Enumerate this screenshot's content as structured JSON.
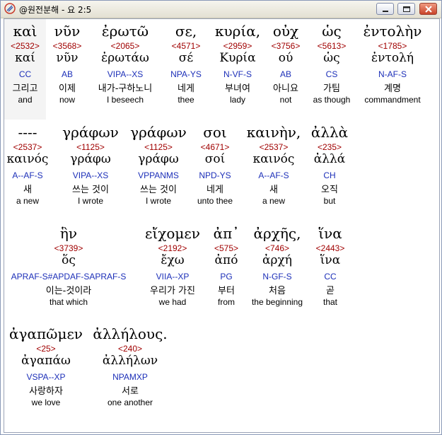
{
  "window": {
    "title": "@원전분해 - 요 2:5"
  },
  "rows": [
    {
      "words": [
        {
          "greek": "καὶ",
          "strong": "<2532>",
          "lemma": "καί",
          "morph": "CC",
          "korean": "그리고",
          "english": "and"
        },
        {
          "greek": "νῦν",
          "strong": "<3568>",
          "lemma": "νῦν",
          "morph": "AB",
          "korean": "이제",
          "english": "now"
        },
        {
          "greek": "ἐρωτῶ",
          "strong": "<2065>",
          "lemma": "ἐρωτάω",
          "morph": "VIPA--XS",
          "korean": "내가-구하노니",
          "english": "I beseech"
        },
        {
          "greek": "σε,",
          "strong": "<4571>",
          "lemma": "σέ",
          "morph": "NPA-YS",
          "korean": "네게",
          "english": "thee"
        },
        {
          "greek": "κυρία,",
          "strong": "<2959>",
          "lemma": "Κυρία",
          "morph": "N-VF-S",
          "korean": "부녀여",
          "english": "lady"
        },
        {
          "greek": "οὐχ",
          "strong": "<3756>",
          "lemma": "ού",
          "morph": "AB",
          "korean": "아니요",
          "english": "not"
        },
        {
          "greek": "ὡς",
          "strong": "<5613>",
          "lemma": "ὡς",
          "morph": "CS",
          "korean": "가팀",
          "english": "as though"
        },
        {
          "greek": "ἐντολὴν",
          "strong": "<1785>",
          "lemma": "ἐντολή",
          "morph": "N-AF-S",
          "korean": "계명",
          "english": "commandment"
        }
      ]
    },
    {
      "words": [
        {
          "greek": "----",
          "strong": "<2537>",
          "lemma": "καινός",
          "morph": "A--AF-S",
          "korean": "새",
          "english": "a new"
        },
        {
          "greek": "γράφων",
          "strong": "<1125>",
          "lemma": "γράφω",
          "morph": "VIPA--XS",
          "korean": "쓰는 것이",
          "english": "I wrote"
        },
        {
          "greek": "γράφων",
          "strong": "<1125>",
          "lemma": "γράφω",
          "morph": "VPPANMS",
          "korean": "쓰는 것이",
          "english": "I wrote"
        },
        {
          "greek": "σοι",
          "strong": "<4671>",
          "lemma": "σοί",
          "morph": "NPD-YS",
          "korean": "네게",
          "english": "unto thee"
        },
        {
          "greek": "καινὴν,",
          "strong": "<2537>",
          "lemma": "καινός",
          "morph": "A--AF-S",
          "korean": "새",
          "english": "a new"
        },
        {
          "greek": "ἀλλὰ",
          "strong": "<235>",
          "lemma": "ἀλλά",
          "morph": "CH",
          "korean": "오직",
          "english": "but"
        }
      ]
    },
    {
      "words": [
        {
          "greek": "ἣν",
          "strong": "<3739>",
          "lemma": "ὅς",
          "morph": "APRAF-S#APDAF-SAPRAF-S",
          "korean": "이는-것이라",
          "english": "that which"
        },
        {
          "greek": "εἴχομεν",
          "strong": "<2192>",
          "lemma": "ἔχω",
          "morph": "VIIA--XP",
          "korean": "우리가 가진",
          "english": "we had"
        },
        {
          "greek": "ἀπ᾽",
          "strong": "<575>",
          "lemma": "ἀπό",
          "morph": "PG",
          "korean": "부터",
          "english": "from"
        },
        {
          "greek": "ἀρχῆς,",
          "strong": "<746>",
          "lemma": "ἀρχή",
          "morph": "N-GF-S",
          "korean": "처음",
          "english": "the beginning"
        },
        {
          "greek": "ἵνα",
          "strong": "<2443>",
          "lemma": "ἵνα",
          "morph": "CC",
          "korean": "곧",
          "english": "that"
        }
      ]
    },
    {
      "words": [
        {
          "greek": "ἀγαπῶμεν",
          "strong": "<25>",
          "lemma": "ἀγαπάω",
          "morph": "VSPA--XP",
          "korean": "사랑하자",
          "english": "we love"
        },
        {
          "greek": "ἀλλήλους.",
          "strong": "<240>",
          "lemma": "ἀλλήλων",
          "morph": "NPAMXP",
          "korean": "서로",
          "english": "one another"
        }
      ]
    }
  ]
}
